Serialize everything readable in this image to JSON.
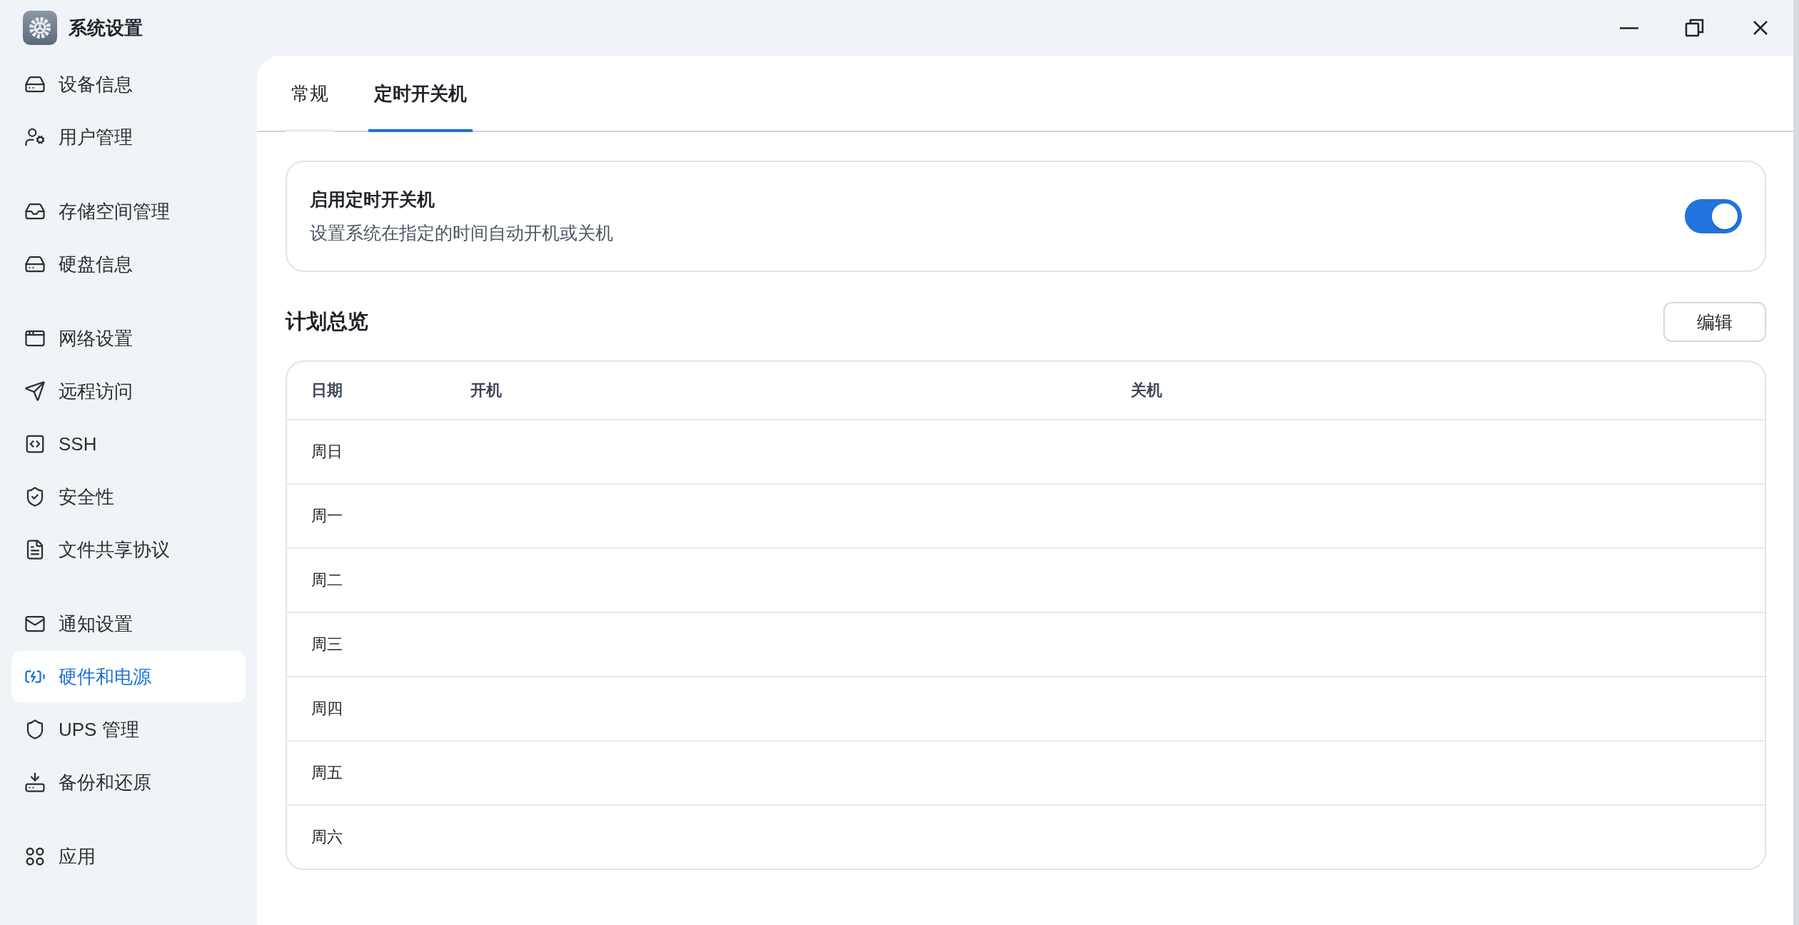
{
  "window": {
    "title": "系统设置"
  },
  "sidebar": {
    "groups": [
      {
        "items": [
          {
            "label": "设备信息",
            "selected": false
          },
          {
            "label": "用户管理",
            "selected": false
          }
        ]
      },
      {
        "items": [
          {
            "label": "存储空间管理",
            "selected": false
          },
          {
            "label": "硬盘信息",
            "selected": false
          }
        ]
      },
      {
        "items": [
          {
            "label": "网络设置",
            "selected": false
          },
          {
            "label": "远程访问",
            "selected": false
          },
          {
            "label": "SSH",
            "selected": false
          },
          {
            "label": "安全性",
            "selected": false
          },
          {
            "label": "文件共享协议",
            "selected": false
          }
        ]
      },
      {
        "items": [
          {
            "label": "通知设置",
            "selected": false
          },
          {
            "label": "硬件和电源",
            "selected": true
          },
          {
            "label": "UPS 管理",
            "selected": false
          },
          {
            "label": "备份和还原",
            "selected": false
          }
        ]
      },
      {
        "items": [
          {
            "label": "应用",
            "selected": false
          }
        ]
      }
    ]
  },
  "tabs": [
    {
      "label": "常规",
      "selected": false
    },
    {
      "label": "定时开关机",
      "selected": true
    }
  ],
  "schedule_toggle": {
    "title": "启用定时开关机",
    "description": "设置系统在指定的时间自动开机或关机",
    "on": true
  },
  "plan": {
    "heading": "计划总览",
    "edit_button": "编辑",
    "table": {
      "columns": [
        "日期",
        "开机",
        "关机"
      ],
      "rows": [
        {
          "day": "周日"
        },
        {
          "day": "周一"
        },
        {
          "day": "周二"
        },
        {
          "day": "周三"
        },
        {
          "day": "周四"
        },
        {
          "day": "周五"
        },
        {
          "day": "周六"
        }
      ]
    }
  }
}
